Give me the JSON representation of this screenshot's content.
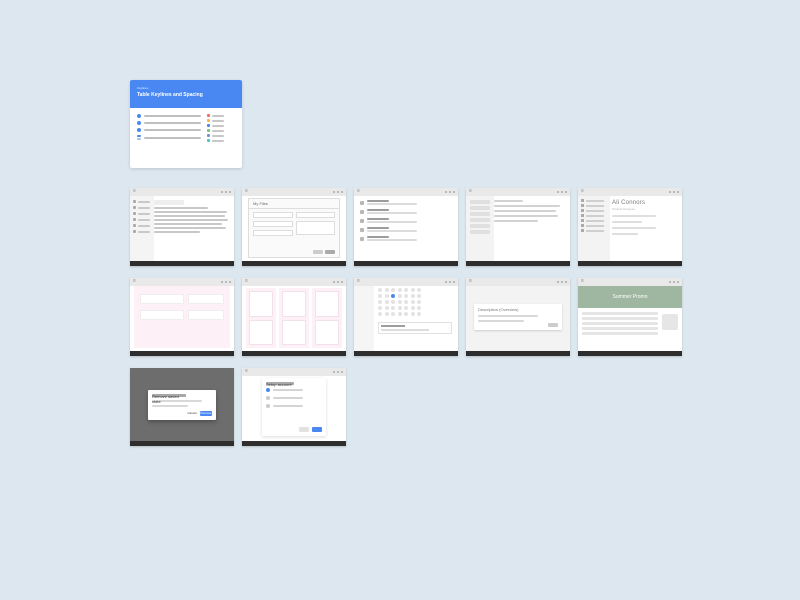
{
  "hero": {
    "subtitle": "Keylines",
    "title": "Table Keylines and Spacing",
    "swatches": [
      "#f36c6c",
      "#ffb14a",
      "#4988f2",
      "#7cc576",
      "#7d8cd8",
      "#4bc3c9"
    ]
  },
  "row1": {
    "m2_header": "My Files",
    "m5_name": "Ali Connors",
    "m5_role": "Product Designer"
  },
  "row2": {
    "m9_title": "Description (Overview)",
    "m10_title": "Summer Promo"
  },
  "row3": {
    "m11_title": "Remove saved state",
    "m11_secondary": "Cancel",
    "m11_primary": "Remove",
    "m12_title": "Setup account"
  }
}
